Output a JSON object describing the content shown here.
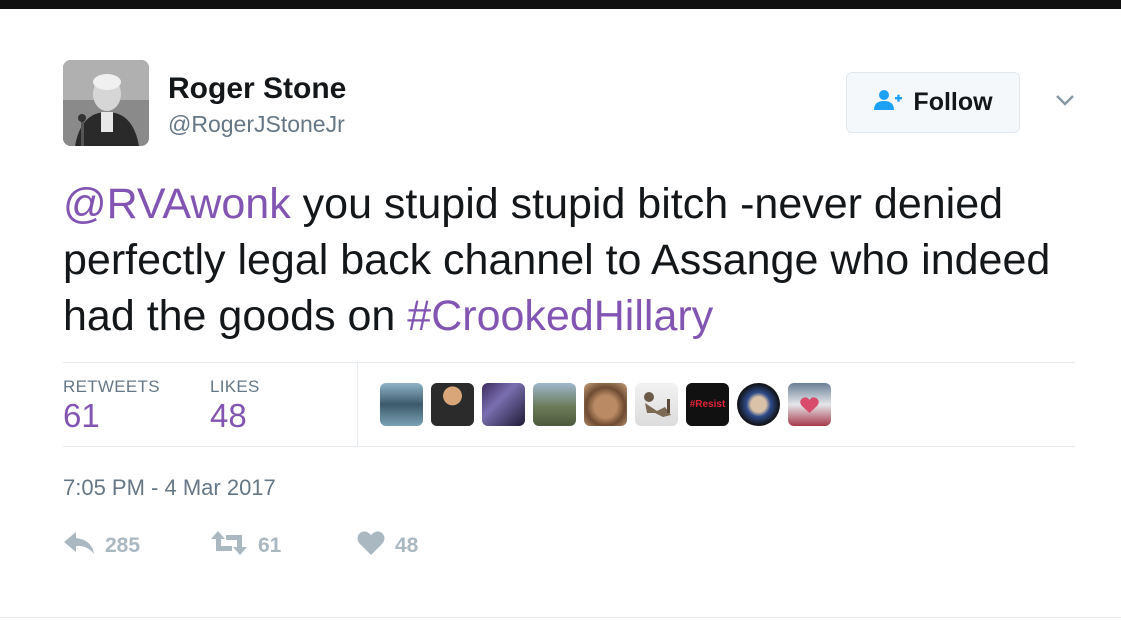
{
  "author": {
    "display_name": "Roger Stone",
    "handle": "@RogerJStoneJr"
  },
  "follow_button": {
    "label": "Follow"
  },
  "tweet": {
    "mention": "@RVAwonk",
    "text_part1": " you stupid stupid bitch -never denied perfectly legal back channel to Assange who indeed had the goods on ",
    "hashtag": "#CrookedHillary"
  },
  "stats": {
    "retweets_label": "RETWEETS",
    "retweets_count": "61",
    "likes_label": "LIKES",
    "likes_count": "48"
  },
  "liker_avatars": [
    {
      "name": "liker-avatar-1"
    },
    {
      "name": "liker-avatar-2"
    },
    {
      "name": "liker-avatar-3"
    },
    {
      "name": "liker-avatar-4"
    },
    {
      "name": "liker-avatar-5"
    },
    {
      "name": "liker-avatar-6"
    },
    {
      "name": "liker-avatar-7",
      "text": "#Resist"
    },
    {
      "name": "liker-avatar-8"
    },
    {
      "name": "liker-avatar-9"
    }
  ],
  "timestamp": "7:05 PM - 4 Mar 2017",
  "actions": {
    "reply_count": "285",
    "retweet_count": "61",
    "like_count": "48"
  },
  "colors": {
    "link": "#8355b3",
    "text": "#14171a",
    "muted": "#657786",
    "action_gray": "#aab8c2",
    "follow_icon": "#1da1f2"
  },
  "icons": [
    "add-user-icon",
    "chevron-down-icon",
    "reply-icon",
    "retweet-icon",
    "heart-icon"
  ]
}
